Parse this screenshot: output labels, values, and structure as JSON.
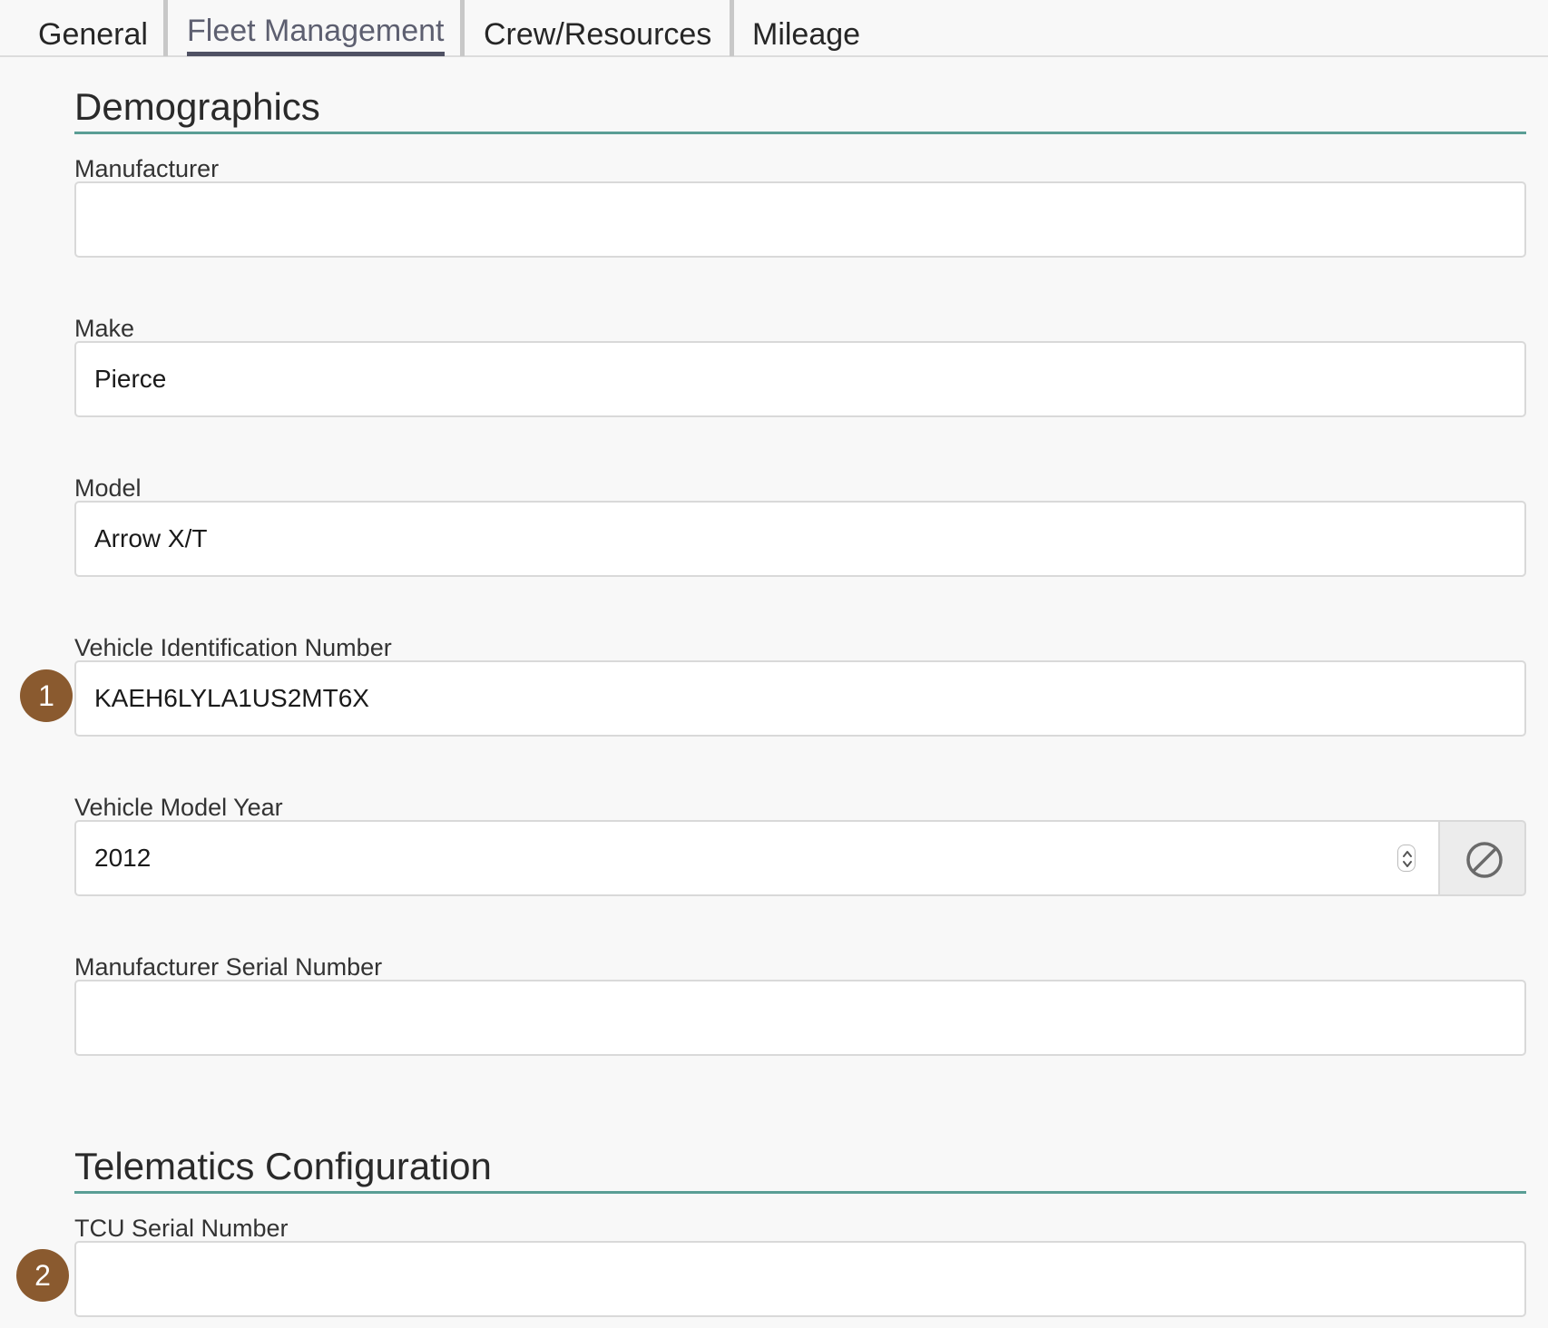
{
  "tabs": [
    {
      "label": "General"
    },
    {
      "label": "Fleet Management",
      "active": true
    },
    {
      "label": "Crew/Resources"
    },
    {
      "label": "Mileage"
    }
  ],
  "sections": {
    "demographics": {
      "title": "Demographics",
      "fields": {
        "manufacturer": {
          "label": "Manufacturer",
          "value": ""
        },
        "make": {
          "label": "Make",
          "value": "Pierce"
        },
        "model": {
          "label": "Model",
          "value": "Arrow X/T"
        },
        "vin": {
          "label": "Vehicle Identification Number",
          "value": "KAEH6LYLA1US2MT6X"
        },
        "model_year": {
          "label": "Vehicle Model Year",
          "value": "2012"
        },
        "manufacturer_serial": {
          "label": "Manufacturer Serial Number",
          "value": ""
        }
      }
    },
    "telematics": {
      "title": "Telematics Configuration",
      "fields": {
        "tcu_serial": {
          "label": "TCU Serial Number",
          "value": ""
        }
      }
    }
  },
  "badges": [
    "1",
    "2"
  ],
  "icons": {
    "spinner": "spinner-arrows-icon",
    "clear": "clear-circle-slash-icon"
  },
  "colors": {
    "section_underline": "#5a9e95",
    "badge": "#8a5a2f",
    "active_tab": "#5d5f70"
  }
}
